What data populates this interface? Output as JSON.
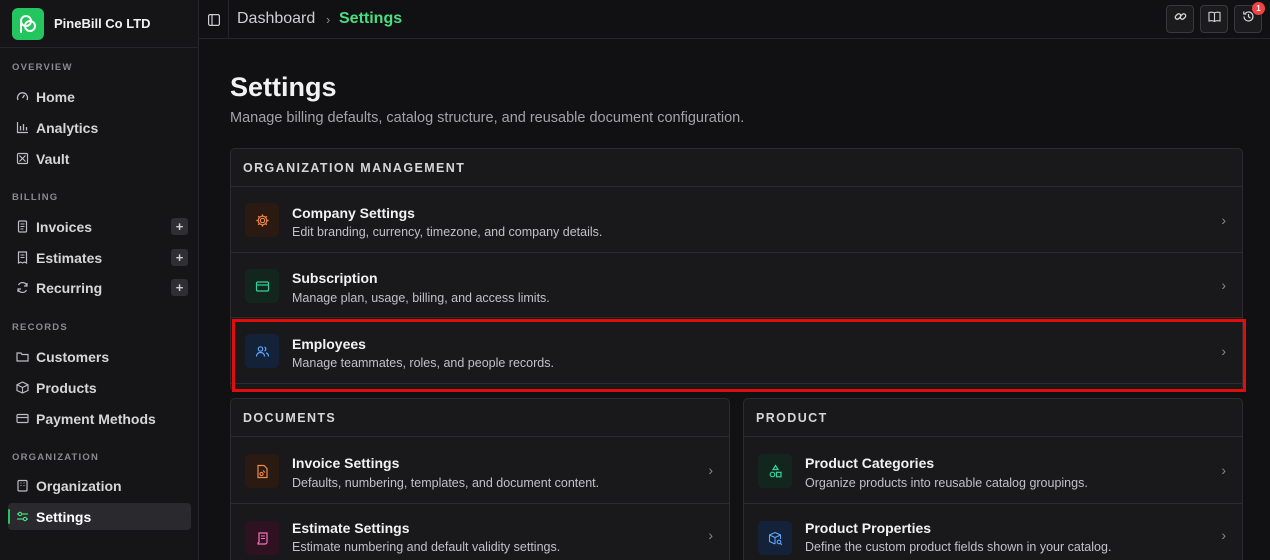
{
  "brand": {
    "name": "PineBill Co LTD"
  },
  "sidebar": {
    "sections": [
      {
        "label": "OVERVIEW"
      },
      {
        "label": "BILLING"
      },
      {
        "label": "RECORDS"
      },
      {
        "label": "ORGANIZATION"
      }
    ],
    "items": [
      {
        "label": "Home",
        "icon": "gauge-icon"
      },
      {
        "label": "Analytics",
        "icon": "bar-chart-icon"
      },
      {
        "label": "Vault",
        "icon": "vault-icon"
      },
      {
        "label": "Invoices",
        "icon": "document-icon"
      },
      {
        "label": "Estimates",
        "icon": "receipt-icon"
      },
      {
        "label": "Recurring",
        "icon": "refresh-icon"
      },
      {
        "label": "Customers",
        "icon": "folder-icon"
      },
      {
        "label": "Products",
        "icon": "box-icon"
      },
      {
        "label": "Payment Methods",
        "icon": "card-icon"
      },
      {
        "label": "Organization",
        "icon": "building-icon"
      },
      {
        "label": "Settings",
        "icon": "sliders-icon"
      }
    ]
  },
  "breadcrumb": {
    "home": "Dashboard",
    "separator": "›",
    "current": "Settings"
  },
  "topbar": {
    "notification_count": "1"
  },
  "page": {
    "title": "Settings",
    "subtitle": "Manage billing defaults, catalog structure, and reusable document configuration."
  },
  "org_management": {
    "header": "ORGANIZATION MANAGEMENT",
    "rows": [
      {
        "title": "Company Settings",
        "desc": "Edit branding, currency, timezone, and company details."
      },
      {
        "title": "Subscription",
        "desc": "Manage plan, usage, billing, and access limits."
      },
      {
        "title": "Employees",
        "desc": "Manage teammates, roles, and people records."
      }
    ]
  },
  "documents": {
    "header": "DOCUMENTS",
    "rows": [
      {
        "title": "Invoice Settings",
        "desc": "Defaults, numbering, templates, and document content."
      },
      {
        "title": "Estimate Settings",
        "desc": "Estimate numbering and default validity settings."
      }
    ]
  },
  "product": {
    "header": "PRODUCT",
    "rows": [
      {
        "title": "Product Categories",
        "desc": "Organize products into reusable catalog groupings."
      },
      {
        "title": "Product Properties",
        "desc": "Define the custom product fields shown in your catalog."
      }
    ]
  },
  "colors": {
    "accent": "#22c55e",
    "highlight": "#e00d0d"
  }
}
